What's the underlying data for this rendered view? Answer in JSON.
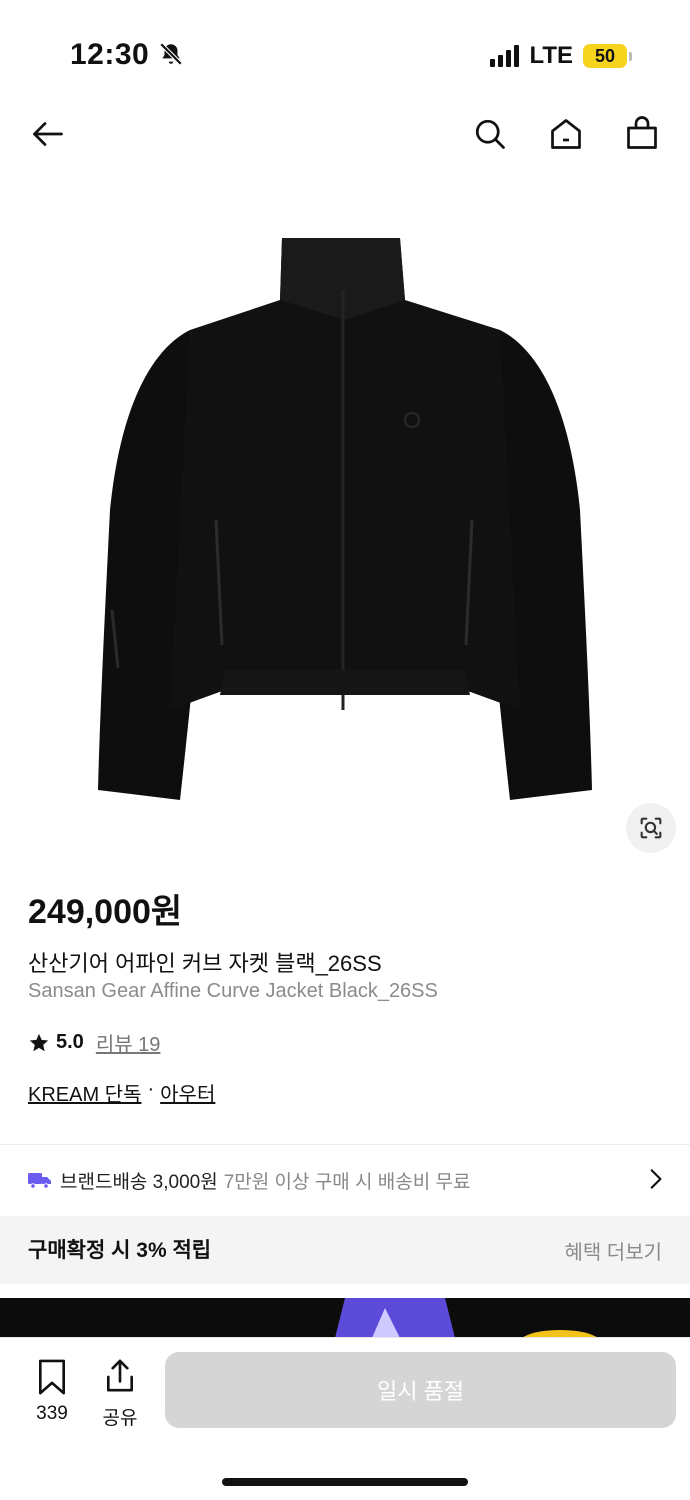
{
  "status_bar": {
    "time": "12:30",
    "network": "LTE",
    "battery": "50"
  },
  "header": {
    "back_icon": "arrow-left-icon",
    "search_icon": "search-icon",
    "home_icon": "home-icon",
    "cart_icon": "shopping-bag-icon"
  },
  "product": {
    "price": "249,000원",
    "name_ko": "산산기어 어파인 커브 자켓 블랙_26SS",
    "name_en": "Sansan Gear Affine Curve Jacket Black_26SS",
    "rating": "5.0",
    "review_label": "리뷰 19",
    "tag_exclusive": "KREAM 단독",
    "tag_separator": "·",
    "tag_category": "아우터"
  },
  "shipping": {
    "title": "브랜드배송 3,000원",
    "note": "7만원 이상 구매 시 배송비 무료"
  },
  "benefit": {
    "left": "구매확정 시 3% 적립",
    "right": "혜택 더보기"
  },
  "bottom_bar": {
    "save_count": "339",
    "share_label": "공유",
    "buy_label": "일시 품절"
  },
  "colors": {
    "accent_purple": "#6b5cf0",
    "battery_yellow": "#f6d31d",
    "soldout_gray": "#d5d5d5"
  }
}
